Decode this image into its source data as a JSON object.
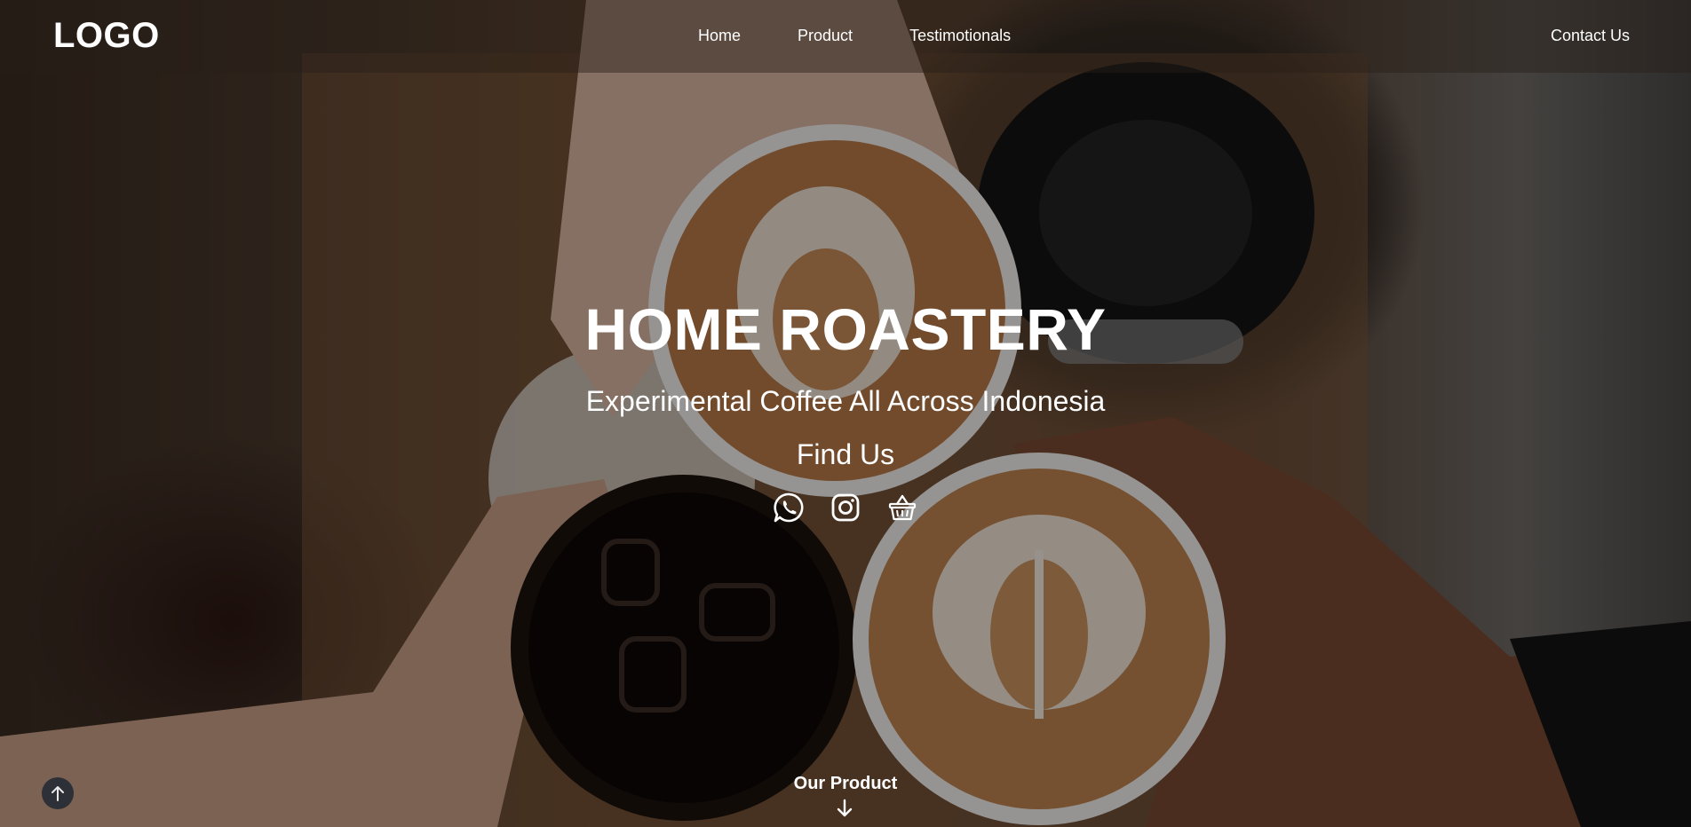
{
  "brand": {
    "logo_text": "LOGO"
  },
  "nav": {
    "items": [
      {
        "label": "Home"
      },
      {
        "label": "Product"
      },
      {
        "label": "Testimotionals"
      }
    ],
    "contact_label": "Contact Us"
  },
  "hero": {
    "title": "HOME ROASTERY",
    "subtitle": "Experimental Coffee All Across Indonesia",
    "find_us": "Find Us",
    "social_icons": [
      "whatsapp-icon",
      "instagram-icon",
      "basket-icon"
    ]
  },
  "footer_cta": {
    "label": "Our Product"
  },
  "colors": {
    "text": "#ffffff",
    "scroll_top_bg": "#2d3036"
  }
}
